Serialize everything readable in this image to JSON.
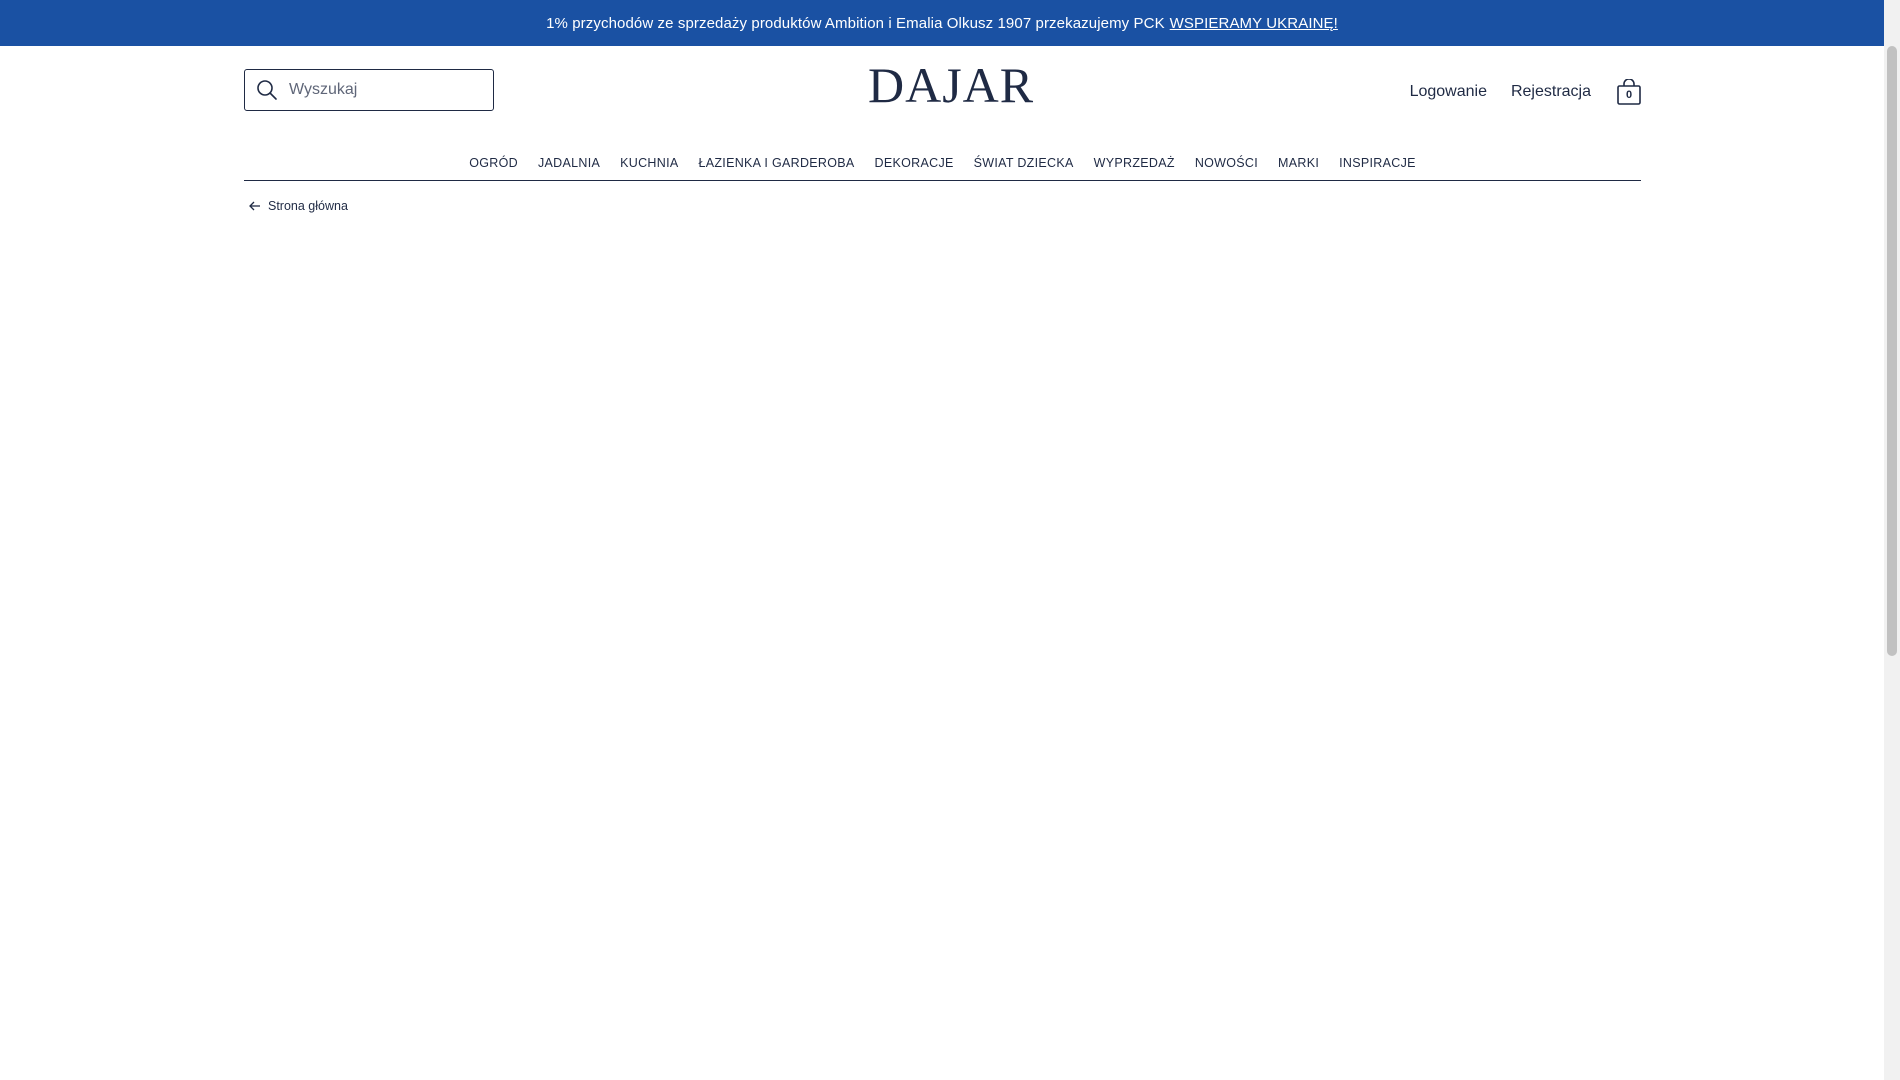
{
  "announcement": {
    "text": "1% przychodów ze sprzedaży produktów Ambition i Emalia Olkusz 1907 przekazujemy PCK",
    "link_label": "WSPIERAMY UKRAINĘ!"
  },
  "search": {
    "placeholder": "Wyszukaj",
    "icon": "search-icon"
  },
  "logo": {
    "text": "DAJAR"
  },
  "account": {
    "login_label": "Logowanie",
    "register_label": "Rejestracja",
    "cart_count": "0",
    "cart_icon": "shopping-bag-icon"
  },
  "nav": {
    "items": [
      {
        "label": "OGRÓD"
      },
      {
        "label": "JADALNIA"
      },
      {
        "label": "KUCHNIA"
      },
      {
        "label": "ŁAZIENKA I GARDEROBA"
      },
      {
        "label": "DEKORACJE"
      },
      {
        "label": "ŚWIAT DZIECKA"
      },
      {
        "label": "WYPRZEDAŻ"
      },
      {
        "label": "NOWOŚCI"
      },
      {
        "label": "MARKI"
      },
      {
        "label": "INSPIRACJE"
      }
    ]
  },
  "breadcrumb": {
    "label": "Strona główna",
    "icon": "arrow-left-icon"
  },
  "colors": {
    "announcement_bg": "#1a51a3",
    "text": "#1f2a44",
    "background": "#ffffff"
  }
}
